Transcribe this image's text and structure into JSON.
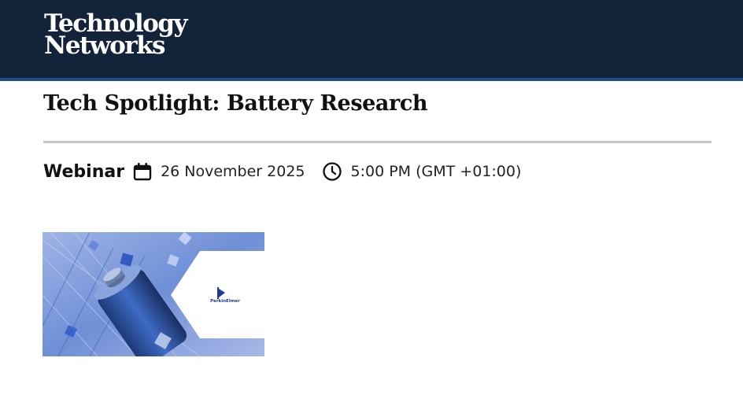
{
  "brand": {
    "line1": "Technology",
    "line2": "Networks"
  },
  "page": {
    "title": "Tech Spotlight: Battery Research"
  },
  "event": {
    "type": "Webinar",
    "date": "26 November 2025",
    "time": "5:00 PM (GMT +01:00)",
    "date_icon": "calendar-icon",
    "time_icon": "clock-icon"
  },
  "thumbnail": {
    "sponsor_logo": "PerkinElmer"
  },
  "colors": {
    "header_bg": "#13233a",
    "header_border": "#1f4e85",
    "divider": "#c6c6c6"
  }
}
